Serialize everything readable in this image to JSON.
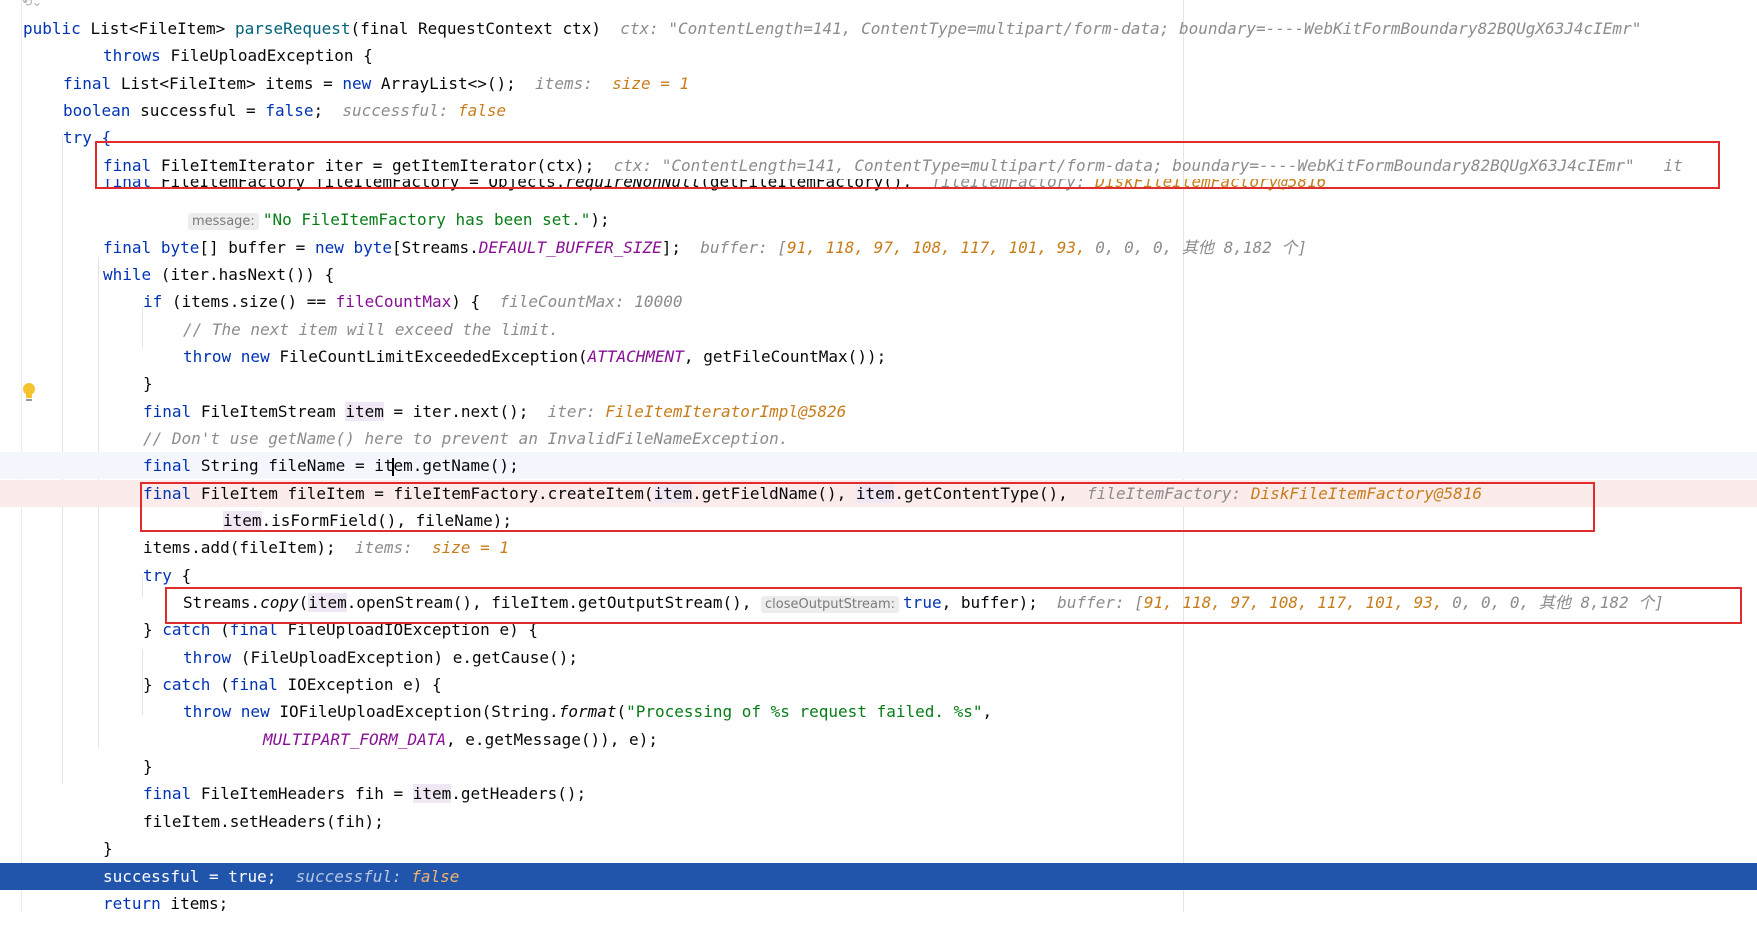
{
  "ui": {
    "fold_icon": "fold-chevron-icon",
    "bulb_icon": "lightbulb-icon"
  },
  "code": {
    "l1_params": "List<FileItem> ",
    "l1_method": "parseRequest",
    "l1_sig": "(final RequestContext ctx)",
    "l1_hint": "ctx: \"ContentLength=141, ContentType=multipart/form-data; boundary=----WebKitFormBoundary82BQUgX63J4cIEmr\"",
    "l2_throws": "FileUploadException {",
    "l3_a": "List<FileItem> items = ",
    "l3_b": "ArrayList<>();",
    "l3_label": "items: ",
    "l3_val": "size = 1",
    "l4_a": "successful = ",
    "l4_b": ";",
    "l4_label": "successful: ",
    "l4_val": "false",
    "l5_try": "try {",
    "l6_a": "FileItemIterator iter = getItemIterator(ctx);",
    "l6_hint": "ctx: \"ContentLength=141, ContentType=multipart/form-data; boundary=----WebKitFormBoundary82BQUgX63J4cIEmr\"",
    "l6_tail": "it",
    "l7_a": "FileItemFactory fileItemFactory = Objects.",
    "l7_b": "requireNonNull",
    "l7_c": "(getFileItemFactory(),",
    "l7_label": "fileItemFactory: ",
    "l7_val": "DiskFileItemFactory@5816",
    "l8_hint": "message:",
    "l8_str": "\"No FileItemFactory has been set.\"",
    "l8_end": ");",
    "l9_a": "byte",
    "l9_b": "[] buffer = ",
    "l9_c": "byte",
    "l9_d": "[Streams.",
    "l9_const": "DEFAULT_BUFFER_SIZE",
    "l9_e": "];",
    "l9_label": "buffer: [",
    "l9_vals": "91, 118, 97, 108, 117, 101, 93, ",
    "l9_rest": "0, 0, 0, 其他 8,182 个]",
    "l10_while": "while",
    "l10_cond": " (iter.hasNext()) {",
    "l11_a": "(items.size() == ",
    "l11_field": "fileCountMax",
    "l11_b": ") {",
    "l11_hint": "fileCountMax: 10000",
    "l12_comment": "// The next item will exceed the limit.",
    "l13_throw": "throw new",
    "l13_a": " FileCountLimitExceededException(",
    "l13_const": "ATTACHMENT",
    "l13_b": ", getFileCountMax());",
    "brace_close": "}",
    "l15_a": "FileItemStream ",
    "l15_item": "item",
    "l15_b": " = iter.next();",
    "l15_label": "iter: ",
    "l15_val": "FileItemIteratorImpl@5826",
    "l16_comment": "// Don't use getName() here to prevent an InvalidFileNameException.",
    "l17_a": "String fileName = it",
    "l17_b": "em.getName();",
    "l18_a": "FileItem fileItem = fileItemFactory.createItem(",
    "l18_item": "item",
    "l18_b": ".getFieldName(), ",
    "l18_c": ".getContentType(),",
    "l18_label": "fileItemFactory: ",
    "l18_val": "DiskFileItemFactory@5816",
    "l19_b": ".isFormField(), fileName);",
    "l20_a": "items.add(fileItem);",
    "l20_label": "items: ",
    "l20_val": "size = 1",
    "l22_a": "Streams.",
    "l22_copy": "copy",
    "l22_b": "(",
    "l22_c": ".openStream(), fileItem.getOutputStream(),",
    "l22_hint": "closeOutputStream:",
    "l22_true": "true",
    "l22_d": ", buffer);",
    "l23_a": "} ",
    "l23_b": "FileUploadIOException e) {",
    "l24_b": " (FileUploadException) e.getCause();",
    "l25_b": "IOException e) {",
    "l26_a": " IOFileUploadException(String.",
    "l26_fmt": "format",
    "l26_b": "(",
    "l26_str": "\"Processing of %s request failed. %s\"",
    "l26_c": ",",
    "l27_const": "MULTIPART_FORM_DATA",
    "l27_a": ", e.getMessage()), e);",
    "l29_a": "FileItemHeaders fih = ",
    "l29_b": ".getHeaders();",
    "l30_a": "fileItem.setHeaders(fih);",
    "l32_a": "successful = ",
    "l32_b": "true",
    "l32_c": ";",
    "l32_label": "successful: ",
    "l32_val": "false",
    "l33_ret": "return",
    "l33_a": " items;"
  },
  "kw": {
    "public": "public",
    "final": "final",
    "throws": "throws",
    "new": "new",
    "boolean": "boolean",
    "false": "false",
    "if": "if",
    "try": "try",
    "catch": "catch",
    "throw": "throw"
  }
}
